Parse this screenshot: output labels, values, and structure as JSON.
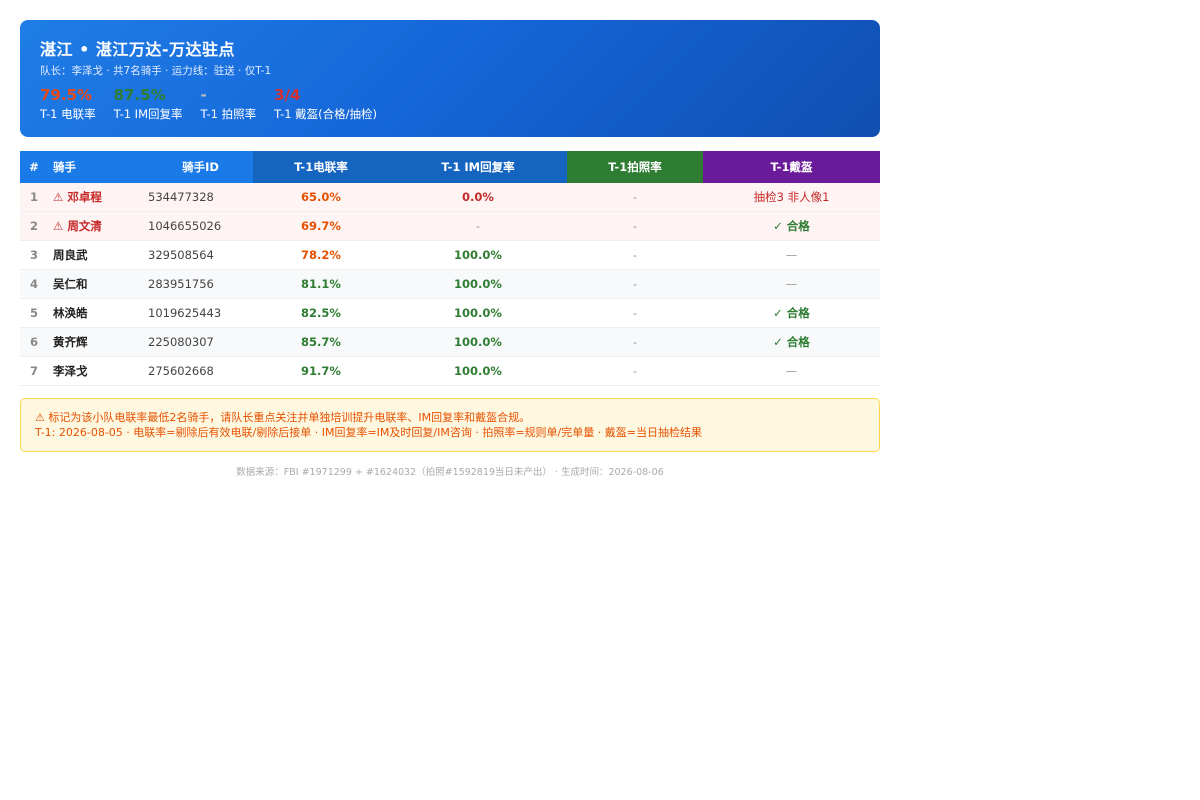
{
  "header": {
    "title": "湛江 • 湛江万达-万达驻点",
    "subtitle": "队长：李泽戈 · 共7名骑手 · 运力线：驻送 · 仅T-1",
    "kpis": [
      {
        "value": "79.5%",
        "label": "T-1 电联率",
        "color": "#e64a19"
      },
      {
        "value": "87.5%",
        "label": "T-1 IM回复率",
        "color": "#2e7d32"
      },
      {
        "value": "-",
        "label": "T-1 拍照率",
        "color": "#bbbbbb"
      },
      {
        "value": "3/4",
        "label": "T-1 戴盔(合格/抽检)",
        "color": "#d32f2f"
      }
    ]
  },
  "table": {
    "headers": [
      "#",
      "骑手",
      "骑手ID",
      "T-1电联率",
      "T-1 IM回复率",
      "T-1拍照率",
      "T-1戴盔"
    ],
    "rows": [
      {
        "idx": "1",
        "name": "⚠ 邓卓程",
        "id": "534477328",
        "rate": "65.0%",
        "im": "0.0%",
        "photo": "-",
        "helmet": "抽检3 非人像1"
      },
      {
        "idx": "2",
        "name": "⚠ 周文清",
        "id": "1046655026",
        "rate": "69.7%",
        "im": "-",
        "photo": "-",
        "helmet": "✓ 合格"
      },
      {
        "idx": "3",
        "name": "周良武",
        "id": "329508564",
        "rate": "78.2%",
        "im": "100.0%",
        "photo": "-",
        "helmet": "—"
      },
      {
        "idx": "4",
        "name": "吴仁和",
        "id": "283951756",
        "rate": "81.1%",
        "im": "100.0%",
        "photo": "-",
        "helmet": "—"
      },
      {
        "idx": "5",
        "name": "林涣皓",
        "id": "1019625443",
        "rate": "82.5%",
        "im": "100.0%",
        "photo": "-",
        "helmet": "✓ 合格"
      },
      {
        "idx": "6",
        "name": "黄齐辉",
        "id": "225080307",
        "rate": "85.7%",
        "im": "100.0%",
        "photo": "-",
        "helmet": "✓ 合格"
      },
      {
        "idx": "7",
        "name": "李泽戈",
        "id": "275602668",
        "rate": "91.7%",
        "im": "100.0%",
        "photo": "-",
        "helmet": "—"
      }
    ]
  },
  "note": {
    "line1": "⚠ 标记为该小队电联率最低2名骑手，请队长重点关注并单独培训提升电联率、IM回复率和戴盔合规。",
    "line2": "T-1: 2026-08-05 · 电联率=剔除后有效电联/剔除后接单 · IM回复率=IM及时回复/IM咨询 · 拍照率=规则单/完单量 · 戴盔=当日抽检结果"
  },
  "footer": {
    "text": "数据来源：FBI #1971299 + #1624032（拍照#1592819当日未产出） · 生成时间：2026-08-06"
  }
}
